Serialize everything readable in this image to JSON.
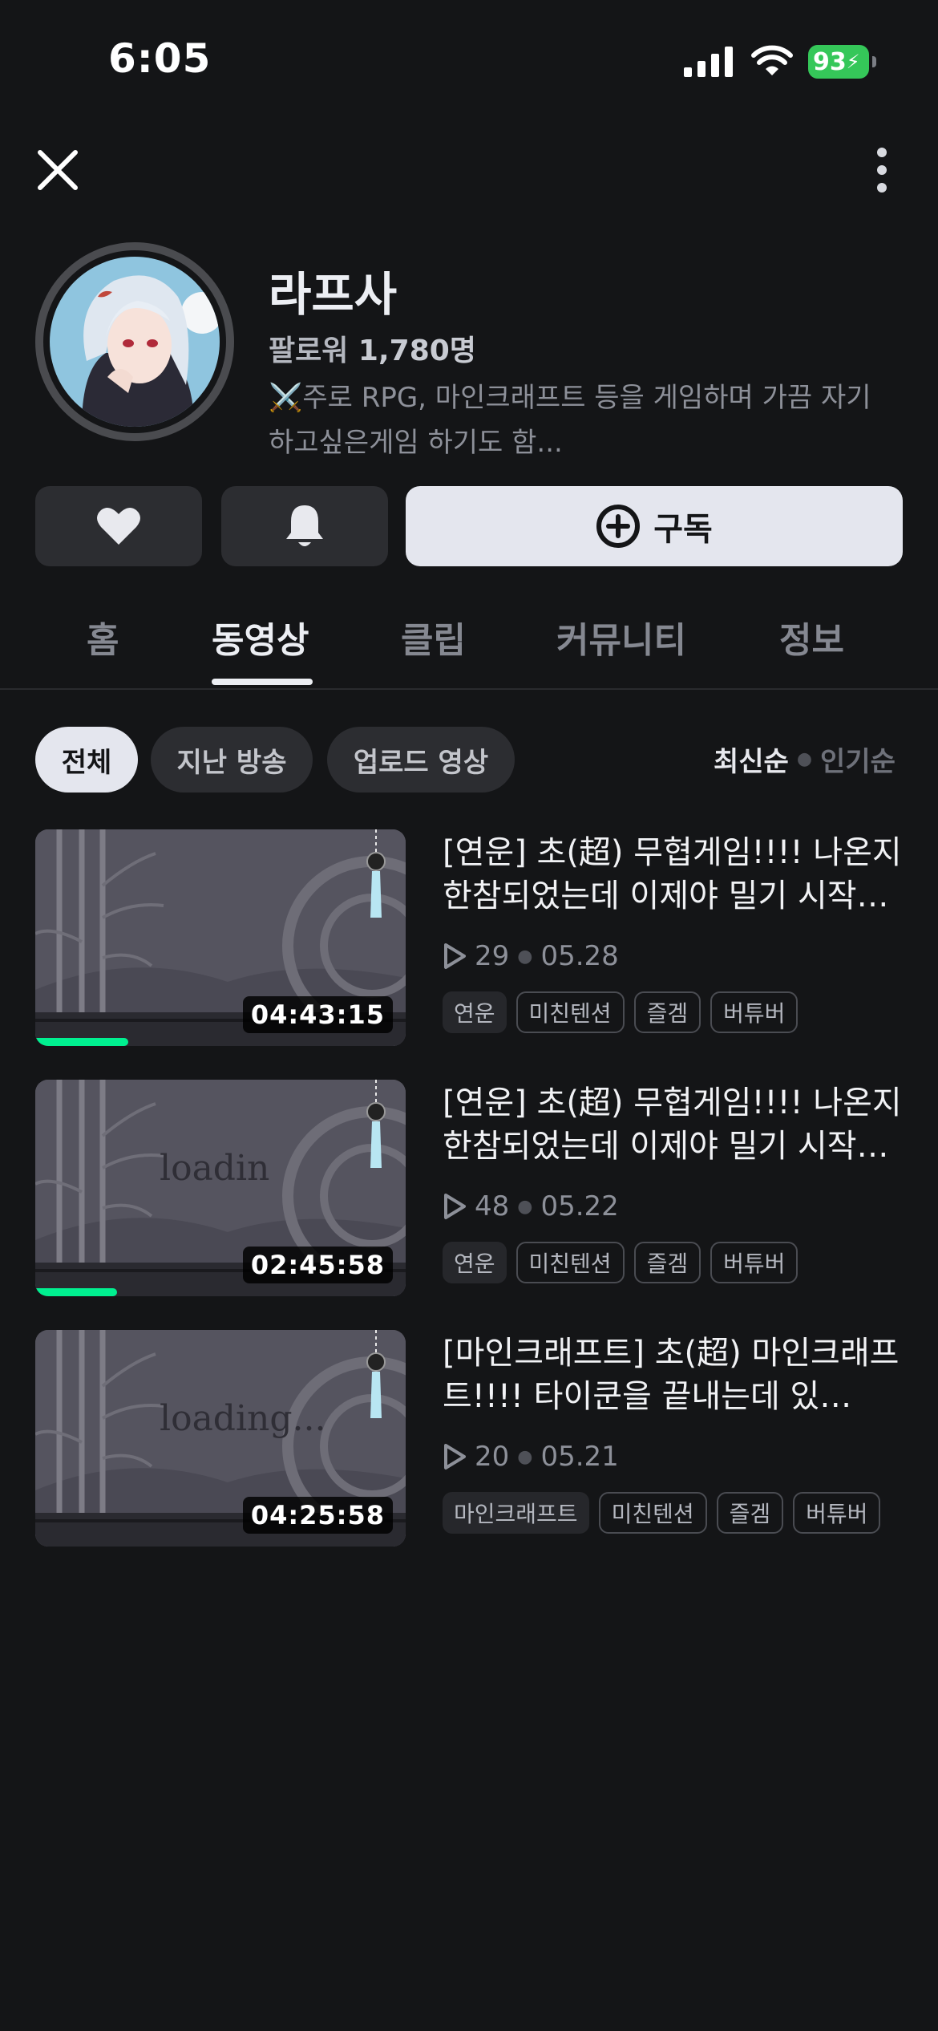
{
  "status_bar": {
    "time": "6:05",
    "battery_level": "93"
  },
  "profile": {
    "name": "라프사",
    "followers_label": "팔로워",
    "followers_count": "1,780명",
    "description": "⚔️주로 RPG, 마인크래프트 등을 게임하며 가끔 자기 하고싶은게임 하기도 함..."
  },
  "actions": {
    "subscribe_label": "구독"
  },
  "tabs": [
    {
      "label": "홈",
      "active": false
    },
    {
      "label": "동영상",
      "active": true
    },
    {
      "label": "클립",
      "active": false
    },
    {
      "label": "커뮤니티",
      "active": false
    },
    {
      "label": "정보",
      "active": false
    }
  ],
  "filters": [
    {
      "label": "전체",
      "active": true
    },
    {
      "label": "지난 방송",
      "active": false
    },
    {
      "label": "업로드 영상",
      "active": false
    }
  ],
  "sort": {
    "selected": "최신순",
    "other": "인기순"
  },
  "videos": [
    {
      "title": "[연운] 초(超) 무협게임!!!! 나온지 한참되었는데 이제야 밀기 시작…",
      "views": "29",
      "date": "05.28",
      "duration": "04:43:15",
      "watched_fraction": 0.25,
      "thumb_text": "",
      "tags": [
        "연운",
        "미친텐션",
        "즐겜",
        "버튜버"
      ]
    },
    {
      "title": "[연운] 초(超) 무협게임!!!! 나온지 한참되었는데 이제야 밀기 시작…",
      "views": "48",
      "date": "05.22",
      "duration": "02:45:58",
      "watched_fraction": 0.22,
      "thumb_text": "loadin",
      "tags": [
        "연운",
        "미친텐션",
        "즐겜",
        "버튜버"
      ]
    },
    {
      "title": "[마인크래프트] 초(超) 마인크래프트!!!! 타이쿤을 끝내는데 있…",
      "views": "20",
      "date": "05.21",
      "duration": "04:25:58",
      "watched_fraction": 0,
      "thumb_text": "loading...",
      "tags": [
        "마인크래프트",
        "미친텐션",
        "즐겜",
        "버튜버"
      ]
    }
  ]
}
